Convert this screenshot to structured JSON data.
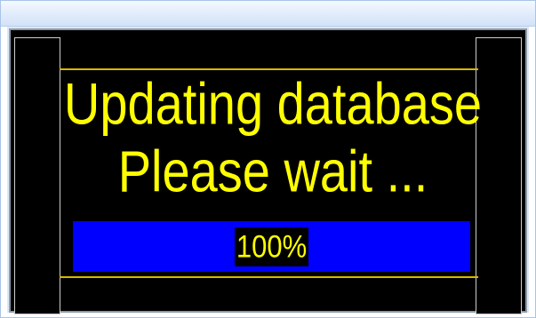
{
  "status": {
    "line1": "Updating database",
    "line2": "Please wait ..."
  },
  "progress": {
    "value": 1.0,
    "label": "100%"
  },
  "colors": {
    "screen_background": "#000000",
    "text": "#ffff00",
    "progress_bar": "#0000ff",
    "divider": "#d8b800"
  }
}
